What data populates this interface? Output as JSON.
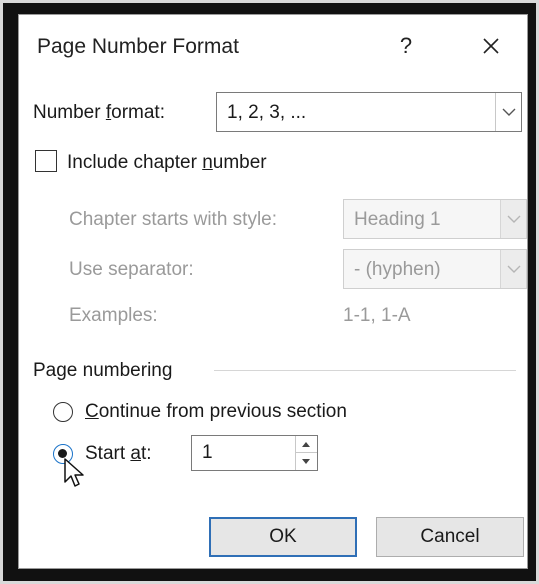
{
  "dialog": {
    "title": "Page Number Format",
    "help_label": "?"
  },
  "number_format": {
    "label_pre": "Number ",
    "label_ul": "f",
    "label_post": "ormat:",
    "value": "1, 2, 3, ..."
  },
  "chapter": {
    "include_label_pre": "Include chapter ",
    "include_label_ul": "n",
    "include_label_post": "umber",
    "include_checked": false,
    "starts_with_label": "Chapter starts with style:",
    "starts_with_value": "Heading 1",
    "separator_label": "Use separator:",
    "separator_value": "-  (hyphen)",
    "examples_label": "Examples:",
    "examples_value": "1-1, 1-A"
  },
  "page_numbering": {
    "group_label": "Page numbering",
    "continue_ul": "C",
    "continue_rest": "ontinue from previous section",
    "start_at_pre": "Start ",
    "start_at_ul": "a",
    "start_at_post": "t:",
    "selected": "start_at",
    "start_value": "1"
  },
  "buttons": {
    "ok": "OK",
    "cancel": "Cancel"
  },
  "colors": {
    "accent": "#2f6fb6",
    "disabled_text": "#9a9a9a"
  }
}
